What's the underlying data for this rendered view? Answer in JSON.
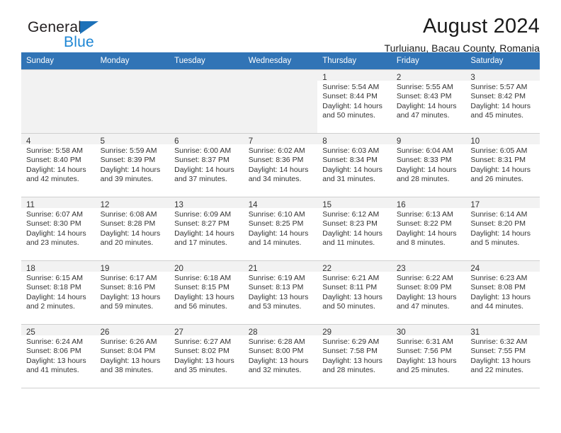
{
  "brand": {
    "name_part1": "General",
    "name_part2": "Blue",
    "triangle_color": "#1d71b8",
    "blue_color": "#1d86d4"
  },
  "header": {
    "month_title": "August 2024",
    "location": "Turluianu, Bacau County, Romania"
  },
  "calendar": {
    "header_bg": "#3174b6",
    "weekdays": [
      "Sunday",
      "Monday",
      "Tuesday",
      "Wednesday",
      "Thursday",
      "Friday",
      "Saturday"
    ],
    "weeks": [
      [
        {
          "empty": true
        },
        {
          "empty": true
        },
        {
          "empty": true
        },
        {
          "empty": true
        },
        {
          "day": "1",
          "sunrise": "Sunrise: 5:54 AM",
          "sunset": "Sunset: 8:44 PM",
          "daylight1": "Daylight: 14 hours",
          "daylight2": "and 50 minutes."
        },
        {
          "day": "2",
          "sunrise": "Sunrise: 5:55 AM",
          "sunset": "Sunset: 8:43 PM",
          "daylight1": "Daylight: 14 hours",
          "daylight2": "and 47 minutes."
        },
        {
          "day": "3",
          "sunrise": "Sunrise: 5:57 AM",
          "sunset": "Sunset: 8:42 PM",
          "daylight1": "Daylight: 14 hours",
          "daylight2": "and 45 minutes."
        }
      ],
      [
        {
          "day": "4",
          "sunrise": "Sunrise: 5:58 AM",
          "sunset": "Sunset: 8:40 PM",
          "daylight1": "Daylight: 14 hours",
          "daylight2": "and 42 minutes."
        },
        {
          "day": "5",
          "sunrise": "Sunrise: 5:59 AM",
          "sunset": "Sunset: 8:39 PM",
          "daylight1": "Daylight: 14 hours",
          "daylight2": "and 39 minutes."
        },
        {
          "day": "6",
          "sunrise": "Sunrise: 6:00 AM",
          "sunset": "Sunset: 8:37 PM",
          "daylight1": "Daylight: 14 hours",
          "daylight2": "and 37 minutes."
        },
        {
          "day": "7",
          "sunrise": "Sunrise: 6:02 AM",
          "sunset": "Sunset: 8:36 PM",
          "daylight1": "Daylight: 14 hours",
          "daylight2": "and 34 minutes."
        },
        {
          "day": "8",
          "sunrise": "Sunrise: 6:03 AM",
          "sunset": "Sunset: 8:34 PM",
          "daylight1": "Daylight: 14 hours",
          "daylight2": "and 31 minutes."
        },
        {
          "day": "9",
          "sunrise": "Sunrise: 6:04 AM",
          "sunset": "Sunset: 8:33 PM",
          "daylight1": "Daylight: 14 hours",
          "daylight2": "and 28 minutes."
        },
        {
          "day": "10",
          "sunrise": "Sunrise: 6:05 AM",
          "sunset": "Sunset: 8:31 PM",
          "daylight1": "Daylight: 14 hours",
          "daylight2": "and 26 minutes."
        }
      ],
      [
        {
          "day": "11",
          "sunrise": "Sunrise: 6:07 AM",
          "sunset": "Sunset: 8:30 PM",
          "daylight1": "Daylight: 14 hours",
          "daylight2": "and 23 minutes."
        },
        {
          "day": "12",
          "sunrise": "Sunrise: 6:08 AM",
          "sunset": "Sunset: 8:28 PM",
          "daylight1": "Daylight: 14 hours",
          "daylight2": "and 20 minutes."
        },
        {
          "day": "13",
          "sunrise": "Sunrise: 6:09 AM",
          "sunset": "Sunset: 8:27 PM",
          "daylight1": "Daylight: 14 hours",
          "daylight2": "and 17 minutes."
        },
        {
          "day": "14",
          "sunrise": "Sunrise: 6:10 AM",
          "sunset": "Sunset: 8:25 PM",
          "daylight1": "Daylight: 14 hours",
          "daylight2": "and 14 minutes."
        },
        {
          "day": "15",
          "sunrise": "Sunrise: 6:12 AM",
          "sunset": "Sunset: 8:23 PM",
          "daylight1": "Daylight: 14 hours",
          "daylight2": "and 11 minutes."
        },
        {
          "day": "16",
          "sunrise": "Sunrise: 6:13 AM",
          "sunset": "Sunset: 8:22 PM",
          "daylight1": "Daylight: 14 hours",
          "daylight2": "and 8 minutes."
        },
        {
          "day": "17",
          "sunrise": "Sunrise: 6:14 AM",
          "sunset": "Sunset: 8:20 PM",
          "daylight1": "Daylight: 14 hours",
          "daylight2": "and 5 minutes."
        }
      ],
      [
        {
          "day": "18",
          "sunrise": "Sunrise: 6:15 AM",
          "sunset": "Sunset: 8:18 PM",
          "daylight1": "Daylight: 14 hours",
          "daylight2": "and 2 minutes."
        },
        {
          "day": "19",
          "sunrise": "Sunrise: 6:17 AM",
          "sunset": "Sunset: 8:16 PM",
          "daylight1": "Daylight: 13 hours",
          "daylight2": "and 59 minutes."
        },
        {
          "day": "20",
          "sunrise": "Sunrise: 6:18 AM",
          "sunset": "Sunset: 8:15 PM",
          "daylight1": "Daylight: 13 hours",
          "daylight2": "and 56 minutes."
        },
        {
          "day": "21",
          "sunrise": "Sunrise: 6:19 AM",
          "sunset": "Sunset: 8:13 PM",
          "daylight1": "Daylight: 13 hours",
          "daylight2": "and 53 minutes."
        },
        {
          "day": "22",
          "sunrise": "Sunrise: 6:21 AM",
          "sunset": "Sunset: 8:11 PM",
          "daylight1": "Daylight: 13 hours",
          "daylight2": "and 50 minutes."
        },
        {
          "day": "23",
          "sunrise": "Sunrise: 6:22 AM",
          "sunset": "Sunset: 8:09 PM",
          "daylight1": "Daylight: 13 hours",
          "daylight2": "and 47 minutes."
        },
        {
          "day": "24",
          "sunrise": "Sunrise: 6:23 AM",
          "sunset": "Sunset: 8:08 PM",
          "daylight1": "Daylight: 13 hours",
          "daylight2": "and 44 minutes."
        }
      ],
      [
        {
          "day": "25",
          "sunrise": "Sunrise: 6:24 AM",
          "sunset": "Sunset: 8:06 PM",
          "daylight1": "Daylight: 13 hours",
          "daylight2": "and 41 minutes."
        },
        {
          "day": "26",
          "sunrise": "Sunrise: 6:26 AM",
          "sunset": "Sunset: 8:04 PM",
          "daylight1": "Daylight: 13 hours",
          "daylight2": "and 38 minutes."
        },
        {
          "day": "27",
          "sunrise": "Sunrise: 6:27 AM",
          "sunset": "Sunset: 8:02 PM",
          "daylight1": "Daylight: 13 hours",
          "daylight2": "and 35 minutes."
        },
        {
          "day": "28",
          "sunrise": "Sunrise: 6:28 AM",
          "sunset": "Sunset: 8:00 PM",
          "daylight1": "Daylight: 13 hours",
          "daylight2": "and 32 minutes."
        },
        {
          "day": "29",
          "sunrise": "Sunrise: 6:29 AM",
          "sunset": "Sunset: 7:58 PM",
          "daylight1": "Daylight: 13 hours",
          "daylight2": "and 28 minutes."
        },
        {
          "day": "30",
          "sunrise": "Sunrise: 6:31 AM",
          "sunset": "Sunset: 7:56 PM",
          "daylight1": "Daylight: 13 hours",
          "daylight2": "and 25 minutes."
        },
        {
          "day": "31",
          "sunrise": "Sunrise: 6:32 AM",
          "sunset": "Sunset: 7:55 PM",
          "daylight1": "Daylight: 13 hours",
          "daylight2": "and 22 minutes."
        }
      ]
    ]
  }
}
